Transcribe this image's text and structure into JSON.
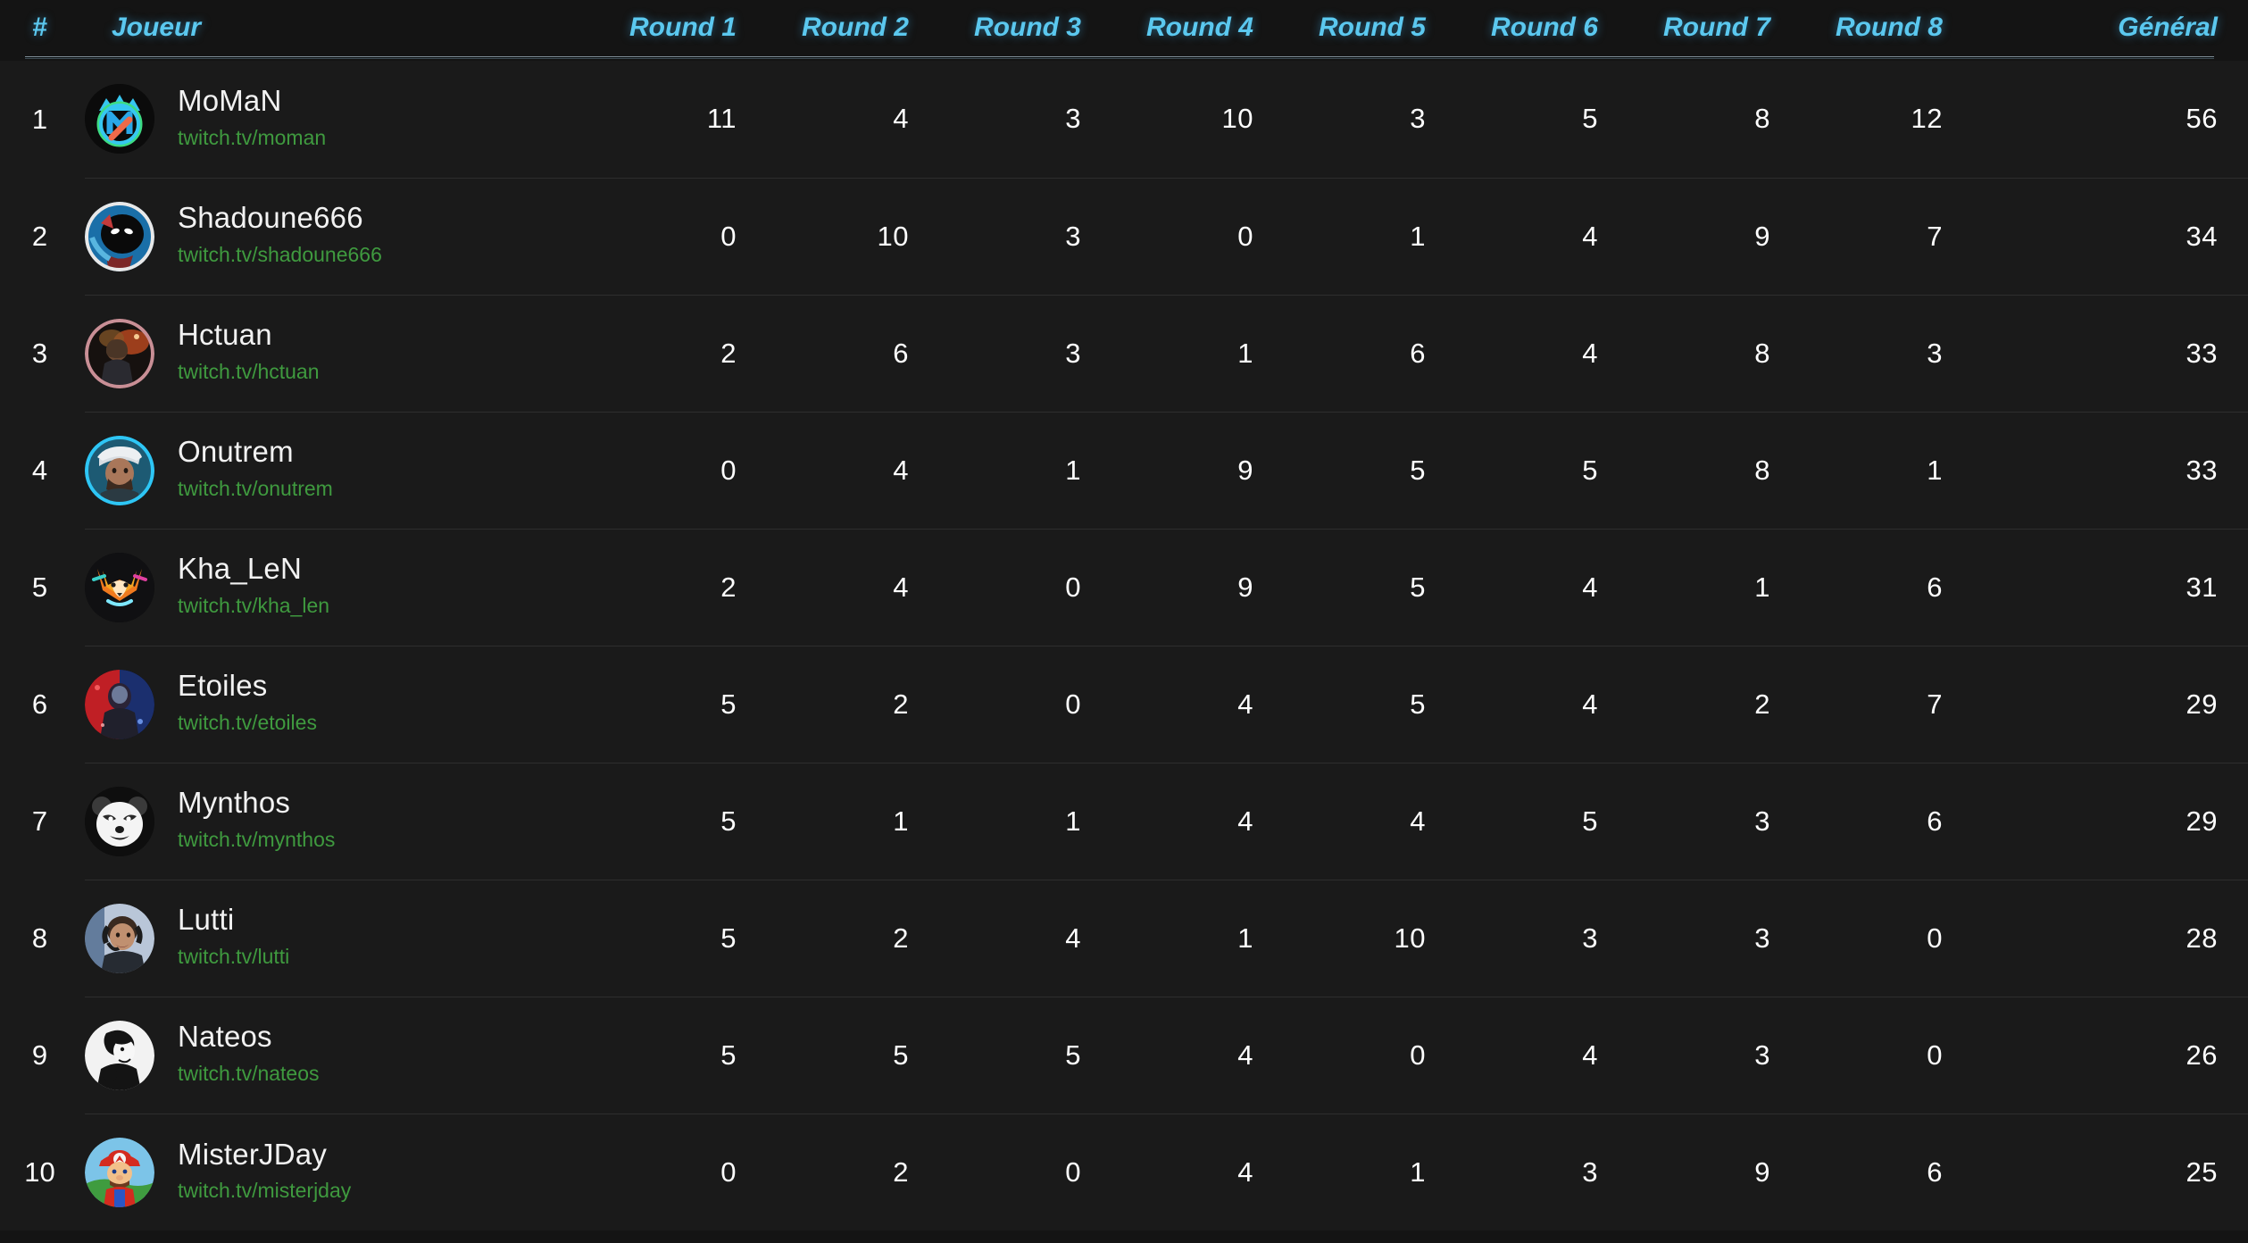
{
  "table": {
    "headers": {
      "rank": "#",
      "player": "Joueur",
      "rounds": [
        "Round 1",
        "Round 2",
        "Round 3",
        "Round 4",
        "Round 5",
        "Round 6",
        "Round 7",
        "Round 8"
      ],
      "total": "Général"
    },
    "colors": {
      "header_text": "#5bc8ef",
      "player_name": "#f2f2f2",
      "player_url": "#3f9a3f",
      "score_text": "#ffffff",
      "row_background": "#1a1a1a",
      "page_background": "#141414",
      "row_divider": "#2e2e2e"
    },
    "rows": [
      {
        "rank": "1",
        "name": "MoMaN",
        "url": "twitch.tv/moman",
        "avatar": "moman-crown-logo-avatar",
        "scores": [
          "11",
          "4",
          "3",
          "10",
          "3",
          "5",
          "8",
          "12"
        ],
        "total": "56"
      },
      {
        "rank": "2",
        "name": "Shadoune666",
        "url": "twitch.tv/shadoune666",
        "avatar": "shadoune666-avatar",
        "scores": [
          "0",
          "10",
          "3",
          "0",
          "1",
          "4",
          "9",
          "7"
        ],
        "total": "34"
      },
      {
        "rank": "3",
        "name": "Hctuan",
        "url": "twitch.tv/hctuan",
        "avatar": "hctuan-avatar",
        "scores": [
          "2",
          "6",
          "3",
          "1",
          "6",
          "4",
          "8",
          "3"
        ],
        "total": "33"
      },
      {
        "rank": "4",
        "name": "Onutrem",
        "url": "twitch.tv/onutrem",
        "avatar": "onutrem-avatar",
        "scores": [
          "0",
          "4",
          "1",
          "9",
          "5",
          "5",
          "8",
          "1"
        ],
        "total": "33"
      },
      {
        "rank": "5",
        "name": "Kha_LeN",
        "url": "twitch.tv/kha_len",
        "avatar": "kha-len-fox-avatar",
        "scores": [
          "2",
          "4",
          "0",
          "9",
          "5",
          "4",
          "1",
          "6"
        ],
        "total": "31"
      },
      {
        "rank": "6",
        "name": "Etoiles",
        "url": "twitch.tv/etoiles",
        "avatar": "etoiles-avatar",
        "scores": [
          "5",
          "2",
          "0",
          "4",
          "5",
          "4",
          "2",
          "7"
        ],
        "total": "29"
      },
      {
        "rank": "7",
        "name": "Mynthos",
        "url": "twitch.tv/mynthos",
        "avatar": "mynthos-panda-avatar",
        "scores": [
          "5",
          "1",
          "1",
          "4",
          "4",
          "5",
          "3",
          "6"
        ],
        "total": "29"
      },
      {
        "rank": "8",
        "name": "Lutti",
        "url": "twitch.tv/lutti",
        "avatar": "lutti-avatar",
        "scores": [
          "5",
          "2",
          "4",
          "1",
          "10",
          "3",
          "3",
          "0"
        ],
        "total": "28"
      },
      {
        "rank": "9",
        "name": "Nateos",
        "url": "twitch.tv/nateos",
        "avatar": "nateos-avatar",
        "scores": [
          "5",
          "5",
          "5",
          "4",
          "0",
          "4",
          "3",
          "0"
        ],
        "total": "26"
      },
      {
        "rank": "10",
        "name": "MisterJDay",
        "url": "twitch.tv/misterjday",
        "avatar": "misterjday-mario-avatar",
        "scores": [
          "0",
          "2",
          "0",
          "4",
          "1",
          "3",
          "9",
          "6"
        ],
        "total": "25"
      }
    ]
  }
}
